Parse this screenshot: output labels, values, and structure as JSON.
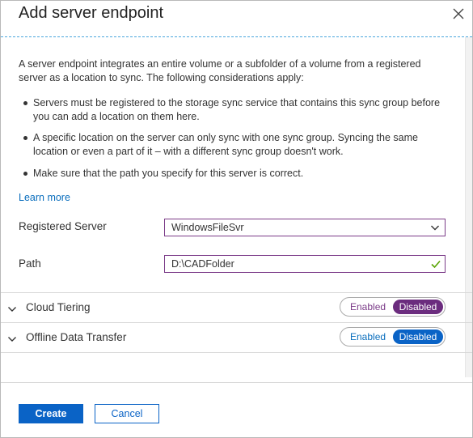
{
  "dialog": {
    "title": "Add server endpoint",
    "intro": "A server endpoint integrates an entire volume or a subfolder of a volume from a registered server as a location to sync. The following considerations apply:",
    "bullets": [
      "Servers must be registered to the storage sync service that contains this sync group before you can add a location on them here.",
      "A specific location on the server can only sync with one sync group. Syncing the same location or even a part of it – with a different sync group doesn't work.",
      "Make sure that the path you specify for this server is correct."
    ],
    "learn_more": "Learn more"
  },
  "form": {
    "registered_server_label": "Registered Server",
    "registered_server_value": "WindowsFileSvr",
    "path_label": "Path",
    "path_value": "D:\\CADFolder"
  },
  "sections": [
    {
      "title": "Cloud Tiering",
      "enabled_label": "Enabled",
      "disabled_label": "Disabled",
      "state": "Disabled",
      "accent": "#6b2c7e"
    },
    {
      "title": "Offline Data Transfer",
      "enabled_label": "Enabled",
      "disabled_label": "Disabled",
      "state": "Disabled",
      "accent": "#0a63c6"
    }
  ],
  "footer": {
    "create_label": "Create",
    "cancel_label": "Cancel"
  },
  "colors": {
    "accent": "#0a63c6",
    "header_divider": "#4aa6dd",
    "field_border": "#7b3b88",
    "valid_check": "#57a300"
  },
  "icons": {
    "close": "close-icon",
    "dropdown": "chevron-down-icon",
    "valid": "checkmark-icon",
    "expand": "chevron-down-icon"
  }
}
